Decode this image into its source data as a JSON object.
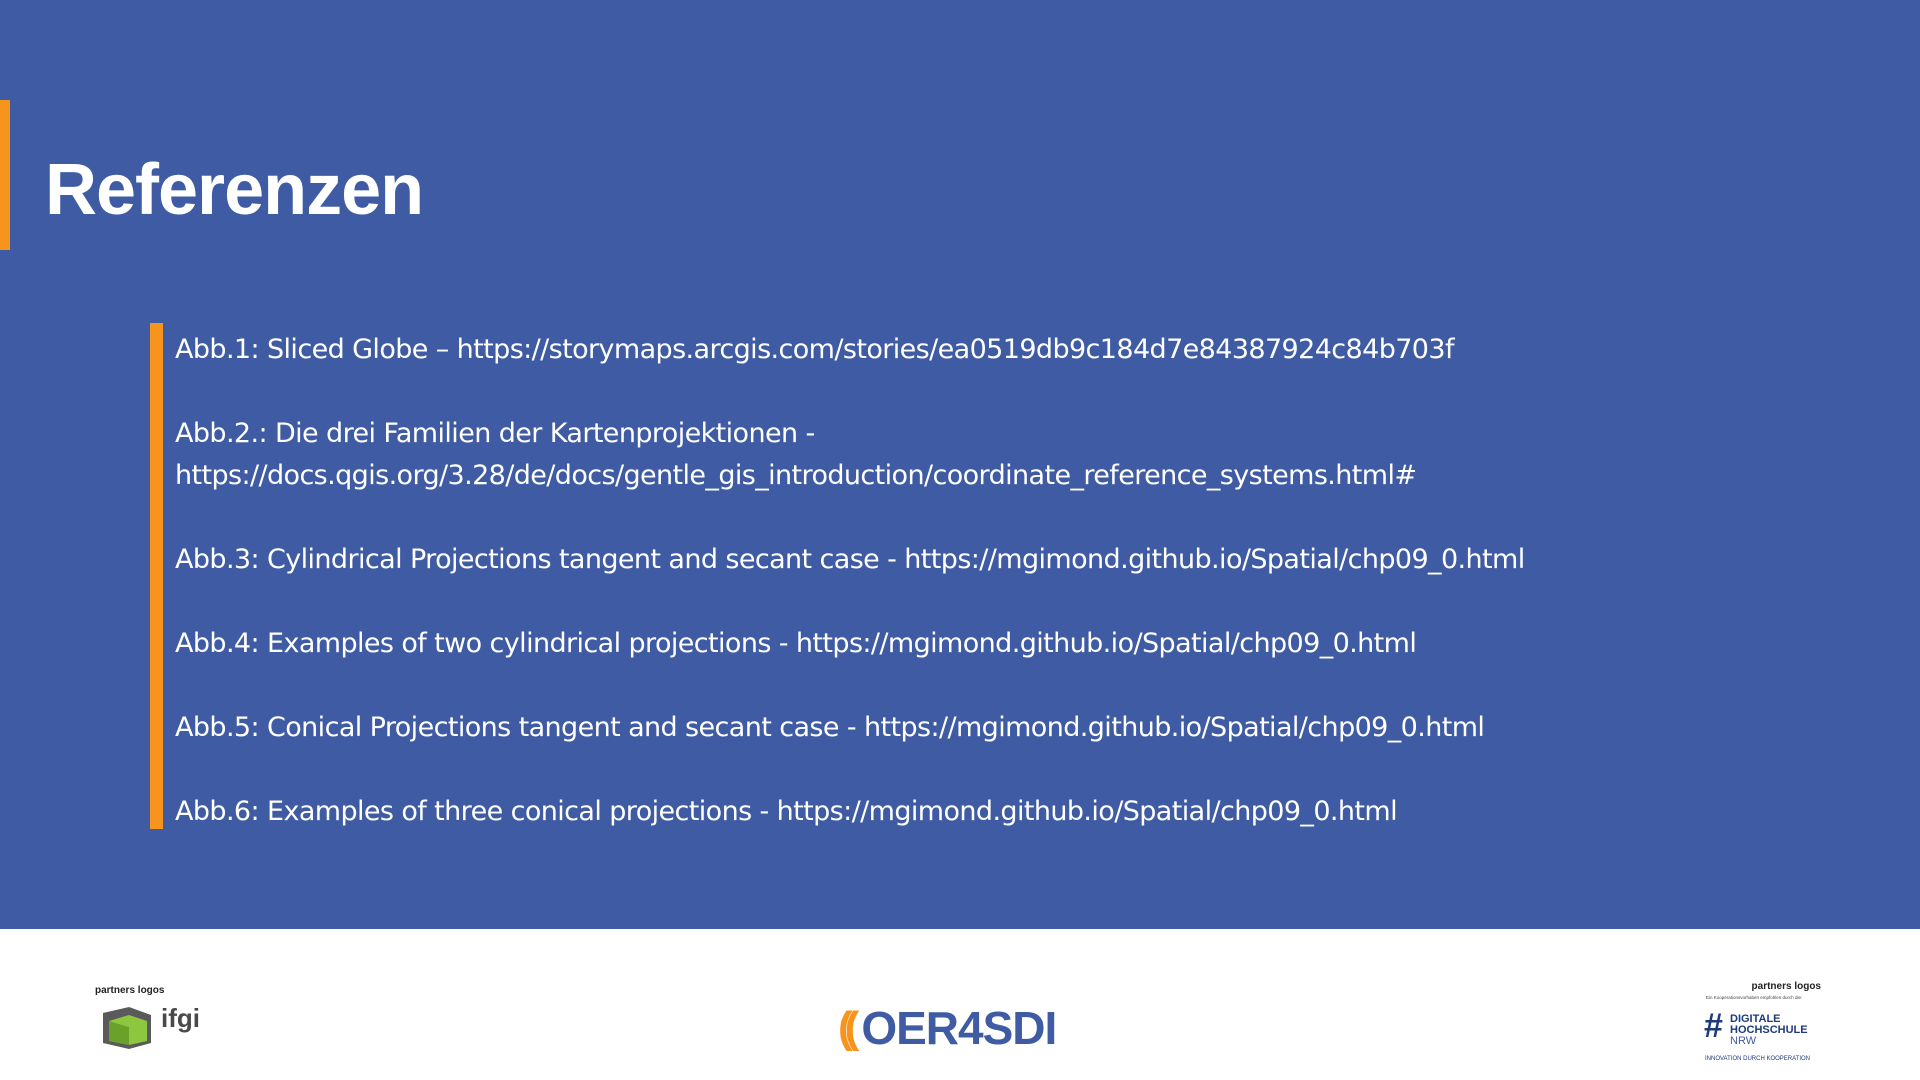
{
  "slide": {
    "title": "Referenzen",
    "references": [
      {
        "lines": [
          "Abb.1: Sliced Globe – https://storymaps.arcgis.com/stories/ea0519db9c184d7e84387924c84b703f"
        ]
      },
      {
        "lines": [
          "Abb.2.: Die drei Familien der Kartenprojektionen -",
          "https://docs.qgis.org/3.28/de/docs/gentle_gis_introduction/coordinate_reference_systems.html#"
        ]
      },
      {
        "lines": [
          "Abb.3: Cylindrical Projections tangent and secant case - https://mgimond.github.io/Spatial/chp09_0.html"
        ]
      },
      {
        "lines": [
          "Abb.4: Examples of two cylindrical projections - https://mgimond.github.io/Spatial/chp09_0.html"
        ]
      },
      {
        "lines": [
          "Abb.5: Conical Projections tangent and secant case - https://mgimond.github.io/Spatial/chp09_0.html"
        ]
      },
      {
        "lines": [
          "Abb.6: Examples of three conical projections - https://mgimond.github.io/Spatial/chp09_0.html"
        ]
      }
    ]
  },
  "footer": {
    "left_partner": {
      "caption": "partners logos",
      "logo_text": "ifgi"
    },
    "brand": {
      "mark": "((",
      "text": "OER4SDI"
    },
    "right_partner": {
      "caption": "partners logos",
      "sub": "Ein Kooperationsvorhaben empfohlen durch die:",
      "logo_line1": "DIGITALE",
      "logo_line2": "HOCHSCHULE",
      "logo_line3": "NRW",
      "tagline": "INNOVATION DURCH KOOPERATION"
    }
  },
  "colors": {
    "background": "#3f5ba3",
    "accent": "#f7941d",
    "text": "#ffffff"
  }
}
